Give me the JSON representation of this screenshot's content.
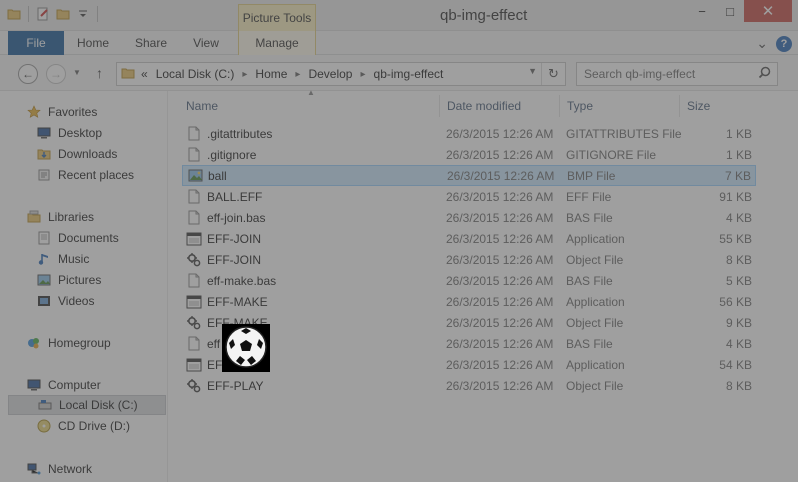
{
  "window": {
    "title": "qb-img-effect",
    "context_tab_group": "Picture Tools",
    "minimize": "−",
    "maximize": "□",
    "close": "✕"
  },
  "ribbon": {
    "tabs": [
      "File",
      "Home",
      "Share",
      "View",
      "Manage"
    ],
    "expand": "⌄",
    "help": "?"
  },
  "address": {
    "crumbs": [
      "«",
      "Local Disk (C:)",
      "Home",
      "Develop",
      "qb-img-effect"
    ],
    "search_placeholder": "Search qb-img-effect"
  },
  "nav": {
    "favorites": "Favorites",
    "desktop": "Desktop",
    "downloads": "Downloads",
    "recent": "Recent places",
    "libraries": "Libraries",
    "documents": "Documents",
    "music": "Music",
    "pictures": "Pictures",
    "videos": "Videos",
    "homegroup": "Homegroup",
    "computer": "Computer",
    "local_disk": "Local Disk (C:)",
    "cd_drive": "CD Drive (D:)",
    "network": "Network"
  },
  "columns": {
    "name": "Name",
    "date": "Date modified",
    "type": "Type",
    "size": "Size"
  },
  "files": [
    {
      "name": ".gitattributes",
      "date": "26/3/2015 12:26 AM",
      "type": "GITATTRIBUTES File",
      "size": "1 KB",
      "icon": "doc"
    },
    {
      "name": ".gitignore",
      "date": "26/3/2015 12:26 AM",
      "type": "GITIGNORE File",
      "size": "1 KB",
      "icon": "doc"
    },
    {
      "name": "ball",
      "date": "26/3/2015 12:26 AM",
      "type": "BMP File",
      "size": "7 KB",
      "icon": "bmp"
    },
    {
      "name": "BALL.EFF",
      "date": "26/3/2015 12:26 AM",
      "type": "EFF File",
      "size": "91 KB",
      "icon": "doc"
    },
    {
      "name": "eff-join.bas",
      "date": "26/3/2015 12:26 AM",
      "type": "BAS File",
      "size": "4 KB",
      "icon": "doc"
    },
    {
      "name": "EFF-JOIN",
      "date": "26/3/2015 12:26 AM",
      "type": "Application",
      "size": "55 KB",
      "icon": "app"
    },
    {
      "name": "EFF-JOIN",
      "date": "26/3/2015 12:26 AM",
      "type": "Object File",
      "size": "8 KB",
      "icon": "obj"
    },
    {
      "name": "eff-make.bas",
      "date": "26/3/2015 12:26 AM",
      "type": "BAS File",
      "size": "5 KB",
      "icon": "doc"
    },
    {
      "name": "EFF-MAKE",
      "date": "26/3/2015 12:26 AM",
      "type": "Application",
      "size": "56 KB",
      "icon": "app"
    },
    {
      "name": "EFF-MAKE",
      "date": "26/3/2015 12:26 AM",
      "type": "Object File",
      "size": "9 KB",
      "icon": "obj"
    },
    {
      "name": "eff",
      "date": "26/3/2015 12:26 AM",
      "type": "BAS File",
      "size": "4 KB",
      "icon": "doc"
    },
    {
      "name": "EFF",
      "date": "26/3/2015 12:26 AM",
      "type": "Application",
      "size": "54 KB",
      "icon": "app"
    },
    {
      "name": "EFF-PLAY",
      "date": "26/3/2015 12:26 AM",
      "type": "Object File",
      "size": "8 KB",
      "icon": "obj"
    }
  ],
  "colors": {
    "file_tab": "#1f5e99",
    "close_button": "#c7504b",
    "context_tab": "#fbf0bf",
    "selection": "#cce8ff"
  }
}
